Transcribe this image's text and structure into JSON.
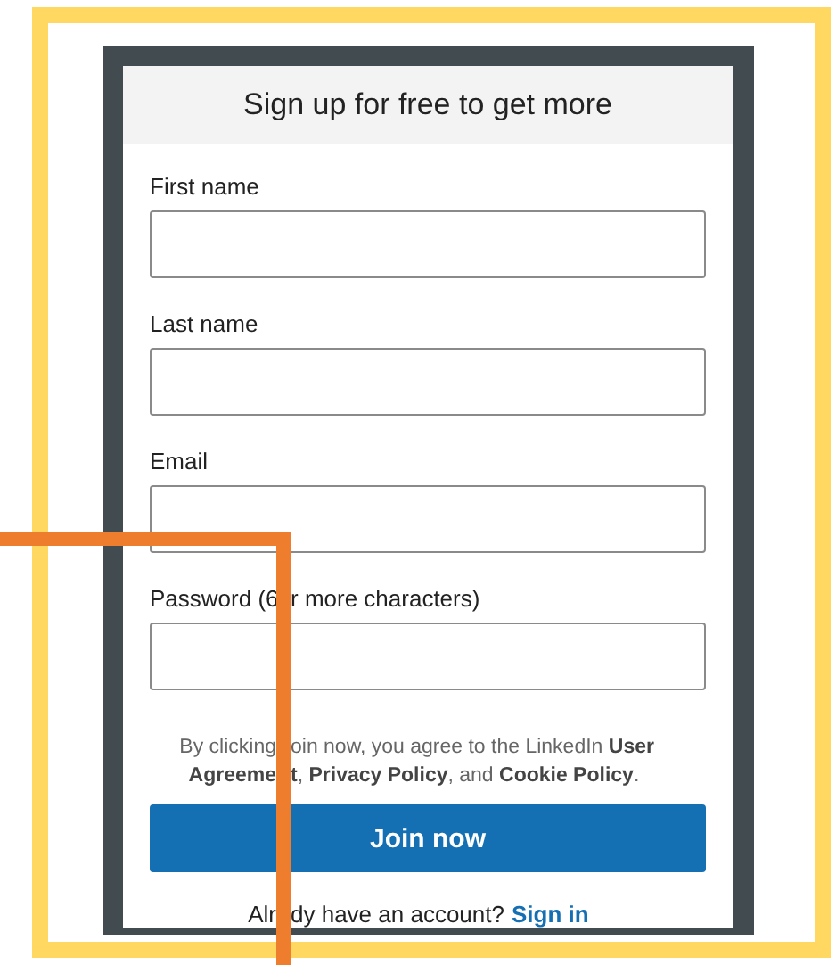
{
  "card": {
    "title": "Sign up for free to get more"
  },
  "fields": [
    {
      "label_parts": [
        "First name"
      ]
    },
    {
      "label_parts": [
        "Last name"
      ]
    },
    {
      "label_parts": [
        "Email"
      ]
    },
    {
      "label_parts": [
        "Password (6",
        "r more characters)"
      ]
    }
  ],
  "legal_lines": [
    [
      "By clicking",
      "oin now, you agree to the LinkedIn **User**"
    ],
    [
      "**Agreeme**",
      "**t**, **Privacy Policy**, and **Cookie Policy**."
    ]
  ],
  "button": "Join now",
  "signin": {
    "prompt_parts": [
      "Alr",
      "dy have an account?"
    ],
    "link": "Sign in"
  }
}
